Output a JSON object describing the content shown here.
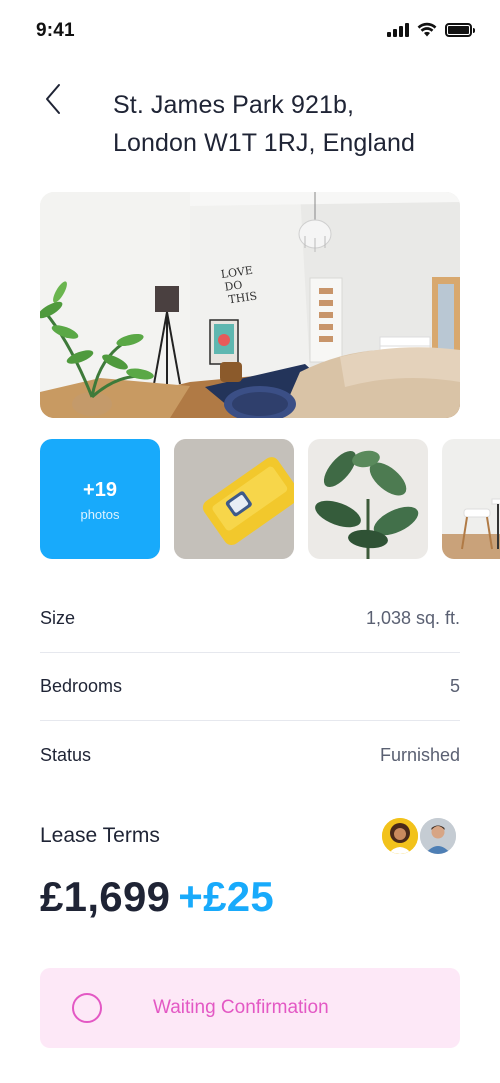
{
  "status_bar": {
    "time": "9:41"
  },
  "header": {
    "back_icon": "chevron-left-icon",
    "address_line1": "St. James Park 921b,",
    "address_line2": "London W1T 1RJ, England"
  },
  "gallery": {
    "hero_alt": "bedroom-photo",
    "more_count": "+19",
    "more_label": "photos",
    "thumbnails": [
      "yellow-sofa-photo",
      "plant-photo",
      "chair-photo"
    ]
  },
  "details": [
    {
      "label": "Size",
      "value": "1,038 sq. ft."
    },
    {
      "label": "Bedrooms",
      "value": "5"
    },
    {
      "label": "Status",
      "value": "Furnished"
    }
  ],
  "lease": {
    "label": "Lease Terms",
    "price": "£1,699",
    "extra": "+£25"
  },
  "status_card": {
    "text": "Waiting Confirmation"
  },
  "colors": {
    "accent": "#18aafb",
    "text": "#1f2435",
    "status_pink": "#e358c4",
    "status_bg": "#fde8f7"
  }
}
